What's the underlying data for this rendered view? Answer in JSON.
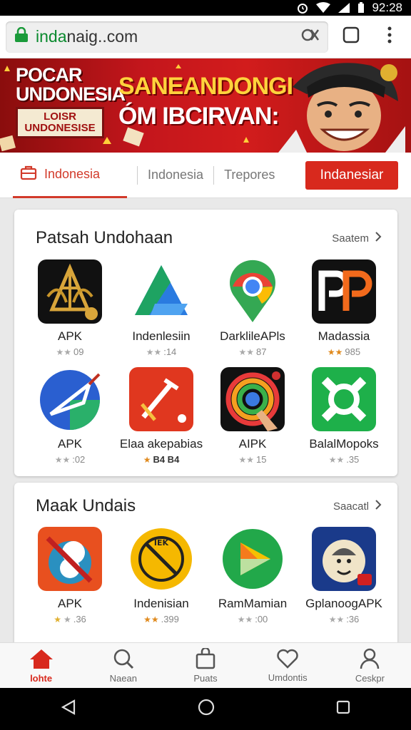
{
  "status_bar": {
    "time": "92:28"
  },
  "url_bar": {
    "url_prefix": "inda",
    "url_rest": "naig..com"
  },
  "banner": {
    "title_line1": "POCAR",
    "title_line2": "UNDONESIA",
    "box_line1": "LOISR",
    "box_line2": "UNDONESISE",
    "headline1": "SANEANDONGI",
    "headline2": "ÓM IBCIRVAN:"
  },
  "tabs": {
    "items": [
      {
        "label": "Indonesia"
      },
      {
        "label": "Indonesia"
      },
      {
        "label": "Trepores"
      }
    ],
    "button_label": "Indanesiar"
  },
  "section1": {
    "title": "Patsah Undohaan",
    "see_more": "Saatem",
    "apps": [
      {
        "name": "APK",
        "rating": "09",
        "stars": "gray"
      },
      {
        "name": "Indenlesiin",
        "rating": ":14",
        "stars": "gray"
      },
      {
        "name": "DarklileAPls",
        "rating": "87",
        "stars": "gray"
      },
      {
        "name": "Madassia",
        "rating": "985",
        "stars": "orange"
      },
      {
        "name": "APK",
        "rating": ":02",
        "stars": "gray"
      },
      {
        "name": "Elaa akepabias",
        "rating": "B4 B4",
        "stars": "orange"
      },
      {
        "name": "AIPK",
        "rating": "15",
        "stars": "gray"
      },
      {
        "name": "BalalMopoks",
        "rating": ".35",
        "stars": "gray"
      }
    ]
  },
  "section2": {
    "title": "Maak Undais",
    "see_more": "Saacatl",
    "apps": [
      {
        "name": "APK",
        "rating": ".36",
        "stars": "orange"
      },
      {
        "name": "Indenisian",
        "rating": ".399",
        "stars": "orange"
      },
      {
        "name": "RamMamian",
        "rating": ":00",
        "stars": "gray"
      },
      {
        "name": "GplanoogAPK",
        "rating": ":36",
        "stars": "gray"
      }
    ]
  },
  "bottom_nav": [
    {
      "label": "lohte",
      "icon": "home-icon"
    },
    {
      "label": "Naean",
      "icon": "search-icon"
    },
    {
      "label": "Puats",
      "icon": "bag-icon"
    },
    {
      "label": "Umdontis",
      "icon": "heart-icon"
    },
    {
      "label": "Ceskpr",
      "icon": "user-icon"
    }
  ],
  "colors": {
    "accent": "#d8291d",
    "url_green": "#0a8a2e",
    "star_orange": "#e08a1e"
  }
}
